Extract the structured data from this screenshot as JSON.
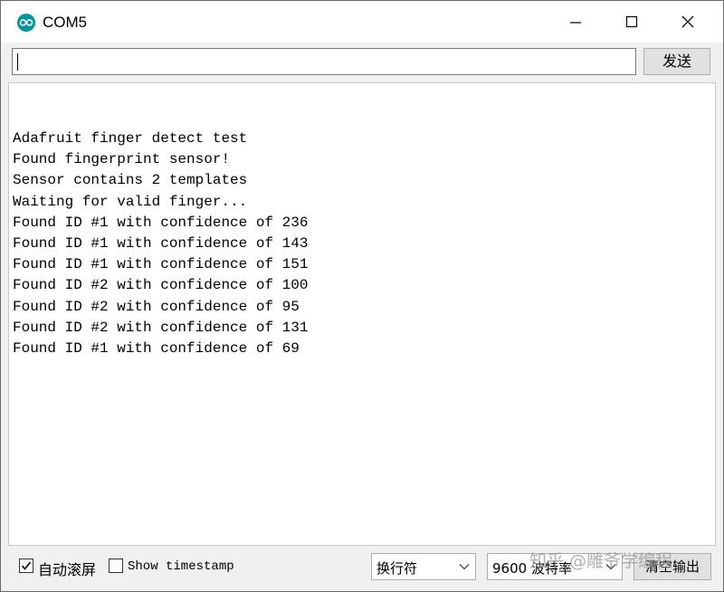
{
  "window": {
    "title": "COM5",
    "icon": "arduino-icon"
  },
  "send": {
    "input_value": "",
    "button_label": "发送"
  },
  "output": {
    "lines": [
      "Adafruit finger detect test",
      "Found fingerprint sensor!",
      "Sensor contains 2 templates",
      "Waiting for valid finger...",
      "Found ID #1 with confidence of 236",
      "Found ID #1 with confidence of 143",
      "Found ID #1 with confidence of 151",
      "Found ID #2 with confidence of 100",
      "Found ID #2 with confidence of 95",
      "Found ID #2 with confidence of 131",
      "Found ID #1 with confidence of 69"
    ]
  },
  "bottom": {
    "autoscroll_label": "自动滚屏",
    "autoscroll_checked": true,
    "timestamp_label": "Show timestamp",
    "timestamp_checked": false,
    "line_ending": "换行符",
    "baud_rate": "9600 波特率",
    "clear_label": "清空输出"
  },
  "watermark": "知乎 @雕爷学编程",
  "colors": {
    "accent": "#00979c"
  }
}
